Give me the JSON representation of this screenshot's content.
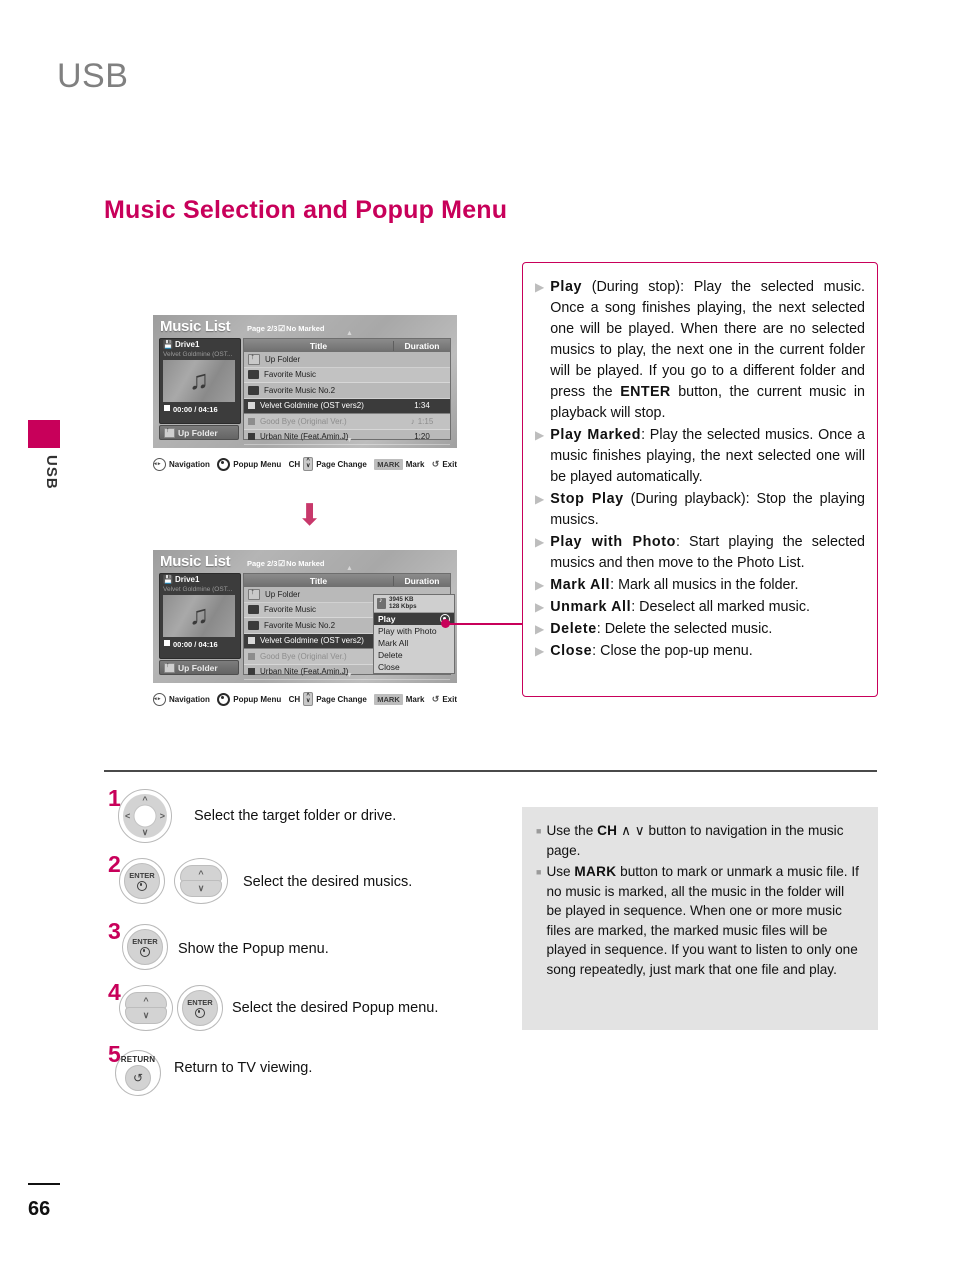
{
  "header": {
    "title": "USB"
  },
  "side_tab": {
    "label": "USB"
  },
  "section": {
    "heading": "Music Selection and Popup Menu"
  },
  "footer": {
    "page_number": "66"
  },
  "tv_screen": {
    "title": "Music List",
    "page_indicator": "Page 2/3",
    "marked_status": "No Marked",
    "marked_check": "☑",
    "drive": {
      "name": "Drive1",
      "now_playing": "Velvet Goldmine (OST...",
      "time": "00:00 / 04:16",
      "up_folder_button": "Up Folder",
      "album_art_icon": "music-note-icon"
    },
    "columns": {
      "title": "Title",
      "duration": "Duration"
    },
    "rows": [
      {
        "icon": "up-folder-icon",
        "title": "Up Folder",
        "duration": "",
        "state": "normal"
      },
      {
        "icon": "folder-icon",
        "title": "Favorite Music",
        "duration": "",
        "state": "normal"
      },
      {
        "icon": "folder-icon",
        "title": "Favorite Music No.2",
        "duration": "",
        "state": "normal"
      },
      {
        "icon": "music-icon",
        "title": "Velvet Goldmine (OST vers2)",
        "duration": "1:34",
        "state": "selected"
      },
      {
        "icon": "music-icon",
        "title": "Good Bye (Original Ver.)",
        "duration": "1:15",
        "state": "dim",
        "badge": "♪"
      },
      {
        "icon": "music-icon",
        "title": "Urban Nite (Feat.Amin.J)",
        "duration": "1:20",
        "state": "normal"
      }
    ],
    "navbar": [
      {
        "icon": "four-way-icon",
        "label": "Navigation"
      },
      {
        "icon": "wheel-icon",
        "label": "Popup Menu"
      },
      {
        "icon": "ch-updown-icon",
        "prefix": "CH",
        "label": "Page Change"
      },
      {
        "icon": "mark-key-icon",
        "key": "MARK",
        "label": "Mark"
      },
      {
        "icon": "return-icon",
        "label": "Exit"
      }
    ],
    "popup": {
      "file_size": "3945 KB",
      "bitrate": "128 Kbps",
      "items": [
        {
          "label": "Play",
          "selected": true
        },
        {
          "label": "Play with Photo",
          "selected": false
        },
        {
          "label": "Mark All",
          "selected": false
        },
        {
          "label": "Delete",
          "selected": false
        },
        {
          "label": "Close",
          "selected": false
        }
      ]
    }
  },
  "description": {
    "items": [
      {
        "term": "Play",
        "rest": " (During stop): Play the selected music. Once a song finishes playing, the next selected one will be played. When there are no selected musics to play, the next one in the current folder will be played. If you go to a different folder and press the ",
        "kbd": "ENTER",
        "tail": " button, the current music in playback will stop."
      },
      {
        "term": "Play Marked",
        "rest": ": Play the selected musics. Once a music finishes playing, the next selected one will be played automatically."
      },
      {
        "term": "Stop Play",
        "rest": " (During playback): Stop the playing musics."
      },
      {
        "term": "Play with Photo",
        "rest": ": Start playing the selected musics and then move to the Photo List."
      },
      {
        "term": "Mark All",
        "rest": ": Mark all musics in the folder."
      },
      {
        "term": "Unmark All",
        "rest": ": Deselect all marked music."
      },
      {
        "term": "Delete",
        "rest": ": Delete the selected music."
      },
      {
        "term": "Close",
        "rest": ": Close the pop-up menu."
      }
    ]
  },
  "steps": [
    {
      "number": "1",
      "text": "Select the target folder or drive.",
      "buttons": [
        "nav-pad"
      ]
    },
    {
      "number": "2",
      "text": "Select the desired musics.",
      "buttons": [
        "enter",
        "rocker"
      ]
    },
    {
      "number": "3",
      "text": "Show the Popup menu.",
      "buttons": [
        "enter"
      ]
    },
    {
      "number": "4",
      "text": "Select the desired Popup menu.",
      "buttons": [
        "rocker",
        "enter"
      ]
    },
    {
      "number": "5",
      "text": "Return to TV viewing.",
      "buttons": [
        "return"
      ]
    }
  ],
  "button_labels": {
    "enter": "ENTER",
    "return": "RETURN"
  },
  "notes": [
    {
      "pre": "Use the ",
      "kbd": "CH",
      "mid": " ∧ ∨ ",
      "post": "button to navigation in the music page."
    },
    {
      "pre": "Use ",
      "kbd": "MARK",
      "mid": " ",
      "post": "button to mark or unmark a music file. If no music is marked, all the music in the folder will be played in sequence. When one or more music files are marked, the marked music files will be played in sequence. If you want to listen to only one song repeatedly, just mark that one file and play."
    }
  ],
  "colors": {
    "accent": "#c8005a",
    "heading": "#c8005a",
    "note_bg": "#e3e3e3",
    "title_gray": "#808080"
  }
}
